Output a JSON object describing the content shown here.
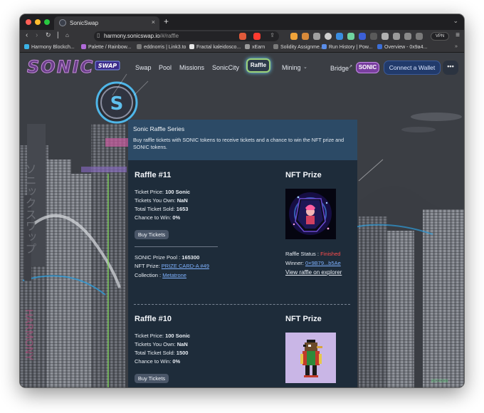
{
  "browser": {
    "tab_title": "SonicSwap",
    "tab_close": "×",
    "new_tab": "+",
    "url_host": "harmony.sonicswap.io",
    "url_path": "/#/raffle",
    "vpn_label": "VPN"
  },
  "bookmarks": [
    {
      "label": "Harmony Blockch...",
      "color": "#3bb2e5"
    },
    {
      "label": "Palette / Rainbow...",
      "color": "#b06bd8"
    },
    {
      "label": "eddnorris | Link3.to",
      "color": "#7a7a7a"
    },
    {
      "label": "Fractal kaleidosco...",
      "color": "#e6e6e6"
    },
    {
      "label": "xEarn",
      "color": "#9b9b9b"
    },
    {
      "label": "Solidity Assignme...",
      "color": "#7a7a7a"
    },
    {
      "label": "Run History | Pow...",
      "color": "#5a8de8"
    },
    {
      "label": "Overview - 0x9a4...",
      "color": "#3c6fd8"
    }
  ],
  "site": {
    "logo_text": "SONIC",
    "logo_sub": "SWAP",
    "emblem_letter": "S",
    "nav": [
      "Swap",
      "Pool",
      "Missions",
      "SonicCity"
    ],
    "raffle_label": "Raffle",
    "mining_label": "Mining",
    "bridge_label": "Bridge",
    "bridge_arrow": "↗",
    "sonic_badge": "SONIC",
    "connect_label": "Connect a Wallet",
    "more_label": "•••",
    "corner_text": "8574398"
  },
  "series": {
    "title": "Sonic Raffle Series",
    "description": "Buy raffle tickets with SONIC tokens to receive tickets and a chance to win the NFT prize and SONIC tokens."
  },
  "raffles": [
    {
      "title": "Raffle #11",
      "ticket_price_label": "Ticket Price:",
      "ticket_price": "100 Sonic",
      "tickets_own_label": "Tickets You Own:",
      "tickets_own": "NaN",
      "total_sold_label": "Total Ticket Sold:",
      "total_sold": "1653",
      "chance_label": "Chance to Win:",
      "chance": "0%",
      "buy_label": "Buy Tickets",
      "prize_pool_label": "SONIC Prize Pool :",
      "prize_pool": "165300",
      "nft_prize_label": "NFT Prize:",
      "nft_prize": "PRIZE CARD-A #49",
      "collection_label": "Collection :",
      "collection": "Metatrone",
      "nft_title": "NFT Prize",
      "status_label": "Raffle Status :",
      "status": "Finished",
      "winner_label": "Winner:",
      "winner": "0×9B79...b5Ae",
      "view_link": "View raffle on explorer"
    },
    {
      "title": "Raffle #10",
      "ticket_price_label": "Ticket Price:",
      "ticket_price": "100 Sonic",
      "tickets_own_label": "Tickets You Own:",
      "tickets_own": "NaN",
      "total_sold_label": "Total Ticket Sold:",
      "total_sold": "1500",
      "chance_label": "Chance to Win:",
      "chance": "0%",
      "buy_label": "Buy Tickets",
      "nft_title": "NFT Prize"
    }
  ],
  "colors": {
    "accent": "#213a6b",
    "series_bg": "#2c4a66",
    "panel_bg": "#1e2c3a",
    "status_finished": "#ff4d4d",
    "link": "#7fb2ff",
    "sonic_badge": "#7a3fa0"
  }
}
